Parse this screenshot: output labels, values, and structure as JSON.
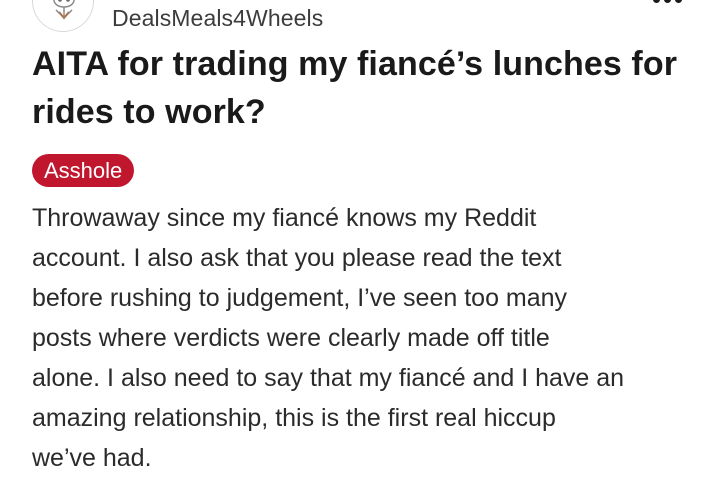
{
  "post": {
    "author": "DealsMeals4Wheels",
    "avatar_icon": "snoo-avatar-icon",
    "more_icon": "more-options-icon",
    "title": "AITA for trading my fiancé’s lunches for rides to work?",
    "flair": {
      "label": "Asshole",
      "color": "#c0162e"
    },
    "body_lines": [
      "Throwaway since my fiancé knows my Reddit",
      "account. I also ask that you please read the text",
      "before rushing to judgement, I’ve seen too many",
      "posts where verdicts were clearly made off title",
      "alone. I also need to say that my fiancé and I have an",
      "amazing relationship, this is the first real hiccup",
      "we’ve had."
    ]
  }
}
